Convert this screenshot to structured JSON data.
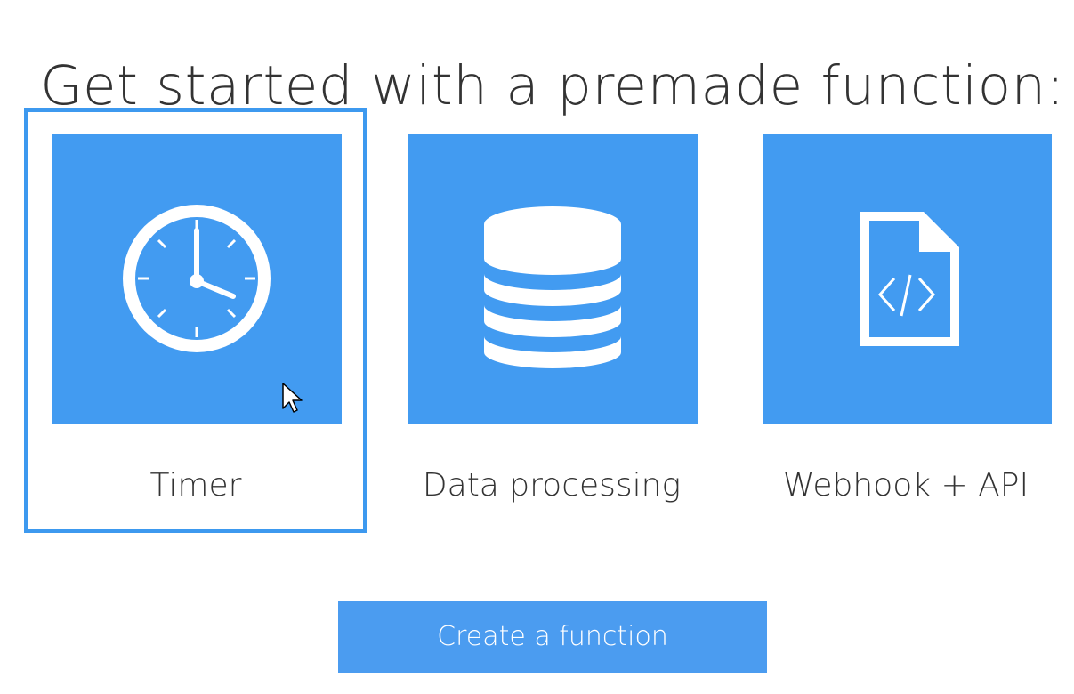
{
  "header": {
    "title": "Get started with a premade function:"
  },
  "templates": [
    {
      "label": "Timer",
      "icon": "clock-icon",
      "selected": true
    },
    {
      "label": "Data processing",
      "icon": "database-icon",
      "selected": false
    },
    {
      "label": "Webhook + API",
      "icon": "code-file-icon",
      "selected": false
    }
  ],
  "actions": {
    "create_label": "Create a function"
  },
  "colors": {
    "tile_background": "#429bf1",
    "selection_border": "#3d99ef",
    "button_background": "#4b9cf0",
    "text": "#333333"
  }
}
